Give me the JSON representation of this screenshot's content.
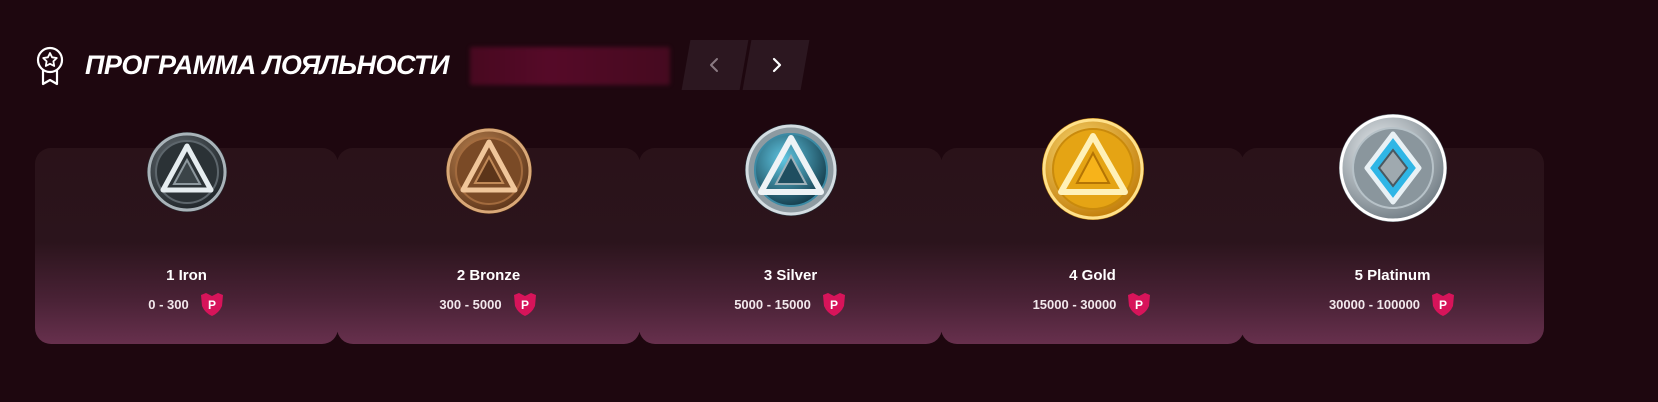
{
  "header": {
    "title": "ПРОГРАММА ЛОЯЛЬНОСТИ",
    "prev_icon": "chevron-left-icon",
    "next_icon": "chevron-right-icon",
    "award_icon": "award-ribbon-icon"
  },
  "levels": [
    {
      "name": "1 Iron",
      "range": "0 - 300",
      "color": "#9aa3aa"
    },
    {
      "name": "2 Bronze",
      "range": "300 - 5000",
      "color": "#b0703f"
    },
    {
      "name": "3 Silver",
      "range": "5000 - 15000",
      "color": "#4fb8d8"
    },
    {
      "name": "4 Gold",
      "range": "15000 - 30000",
      "color": "#f2b51c"
    },
    {
      "name": "5 Platinum",
      "range": "30000 - 100000",
      "color": "#37c8f2"
    }
  ],
  "points_icon": {
    "letter": "P",
    "color": "#e0175f"
  }
}
